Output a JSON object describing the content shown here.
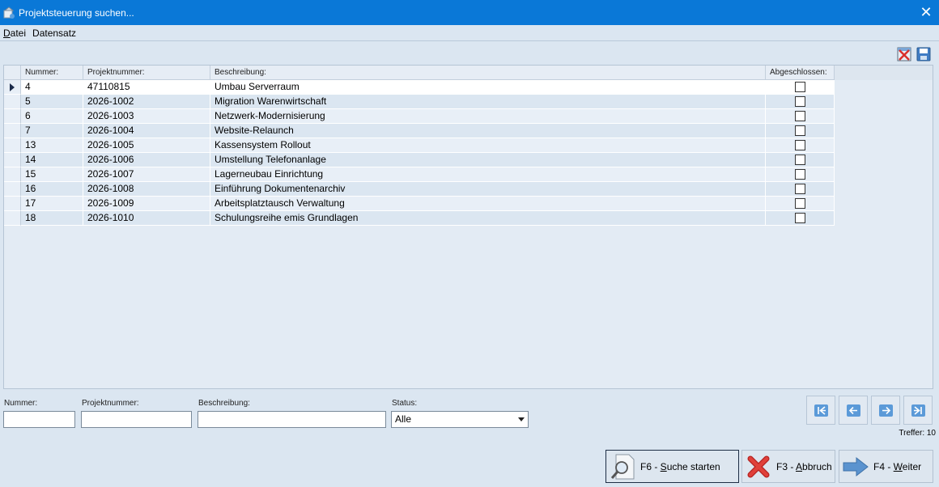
{
  "window": {
    "title": "Projektsteuerung suchen...",
    "close_symbol": "✕"
  },
  "menu": {
    "items": [
      {
        "label": "Datei",
        "accel": "D",
        "rest": "atei"
      },
      {
        "label": "Datensatz",
        "accel": "",
        "rest": "Datensatz"
      }
    ]
  },
  "toolbar": {
    "icons": [
      "delete-record-icon",
      "save-icon"
    ]
  },
  "grid": {
    "columns": [
      "Nummer:",
      "Projektnummer:",
      "Beschreibung:",
      "Abgeschlossen:"
    ],
    "rows": [
      {
        "nummer": "4",
        "projektnummer": "47110815",
        "beschreibung": "Umbau Serverraum",
        "abgeschlossen": false
      },
      {
        "nummer": "5",
        "projektnummer": "2026-1002",
        "beschreibung": "Migration Warenwirtschaft",
        "abgeschlossen": false
      },
      {
        "nummer": "6",
        "projektnummer": "2026-1003",
        "beschreibung": "Netzwerk-Modernisierung",
        "abgeschlossen": false
      },
      {
        "nummer": "7",
        "projektnummer": "2026-1004",
        "beschreibung": "Website-Relaunch",
        "abgeschlossen": false
      },
      {
        "nummer": "13",
        "projektnummer": "2026-1005",
        "beschreibung": "Kassensystem Rollout",
        "abgeschlossen": false
      },
      {
        "nummer": "14",
        "projektnummer": "2026-1006",
        "beschreibung": "Umstellung Telefonanlage",
        "abgeschlossen": false
      },
      {
        "nummer": "15",
        "projektnummer": "2026-1007",
        "beschreibung": "Lagerneubau Einrichtung",
        "abgeschlossen": false
      },
      {
        "nummer": "16",
        "projektnummer": "2026-1008",
        "beschreibung": "Einführung Dokumentenarchiv",
        "abgeschlossen": false
      },
      {
        "nummer": "17",
        "projektnummer": "2026-1009",
        "beschreibung": "Arbeitsplatztausch Verwaltung",
        "abgeschlossen": false
      },
      {
        "nummer": "18",
        "projektnummer": "2026-1010",
        "beschreibung": "Schulungsreihe emis Grundlagen",
        "abgeschlossen": false
      }
    ]
  },
  "filters": {
    "nummer_label": "Nummer:",
    "nummer_value": "",
    "projektnummer_label": "Projektnummer:",
    "projektnummer_value": "",
    "beschreibung_label": "Beschreibung:",
    "beschreibung_value": "",
    "status_label": "Status:",
    "status_value": "Alle"
  },
  "navigation": {
    "buttons": [
      "first-record",
      "previous-record",
      "next-record",
      "last-record"
    ]
  },
  "treffer": "Treffer: 10",
  "actions": {
    "search": {
      "prefix": "F6 - ",
      "accel": "S",
      "rest": "uche starten"
    },
    "cancel": {
      "prefix": "F3 - ",
      "accel": "A",
      "rest": "bbruch"
    },
    "next": {
      "prefix": "F4 - ",
      "accel": "W",
      "rest": "eiter"
    }
  },
  "colors": {
    "titlebar": "#0a78d7",
    "background": "#dbe6f1",
    "nav_icon": "#5b9ad8",
    "cancel_red": "#d9302c"
  }
}
